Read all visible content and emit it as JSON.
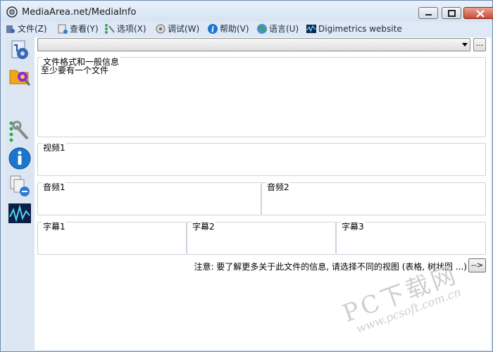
{
  "window": {
    "title": "MediaArea.net/MediaInfo"
  },
  "menu": [
    {
      "label": "文件(Z)",
      "icon": "file-icon"
    },
    {
      "label": "查看(Y)",
      "icon": "view-icon"
    },
    {
      "label": "选项(X)",
      "icon": "options-icon"
    },
    {
      "label": "调试(W)",
      "icon": "debug-icon"
    },
    {
      "label": "帮助(V)",
      "icon": "help-icon"
    },
    {
      "label": "语言(U)",
      "icon": "language-icon"
    },
    {
      "label": "Digimetrics website",
      "icon": "digimetrics-icon"
    }
  ],
  "file_selector": {
    "value": "",
    "browse_label": "..."
  },
  "sidebar": [
    "open-file-icon",
    "open-folder-icon",
    "preferences-icon",
    "about-icon",
    "export-icon",
    "digimetrics-icon"
  ],
  "sections": {
    "general": {
      "label": "文件格式和一般信息",
      "content": "至少要有一个文件"
    },
    "video1": {
      "label": "视频1"
    },
    "audio1": {
      "label": "音频1"
    },
    "audio2": {
      "label": "音频2"
    },
    "subtitle1": {
      "label": "字幕1"
    },
    "subtitle2": {
      "label": "字幕2"
    },
    "subtitle3": {
      "label": "字幕3"
    }
  },
  "footer": {
    "note": "注意: 要了解更多关于此文件的信息, 请选择不同的视图 (表格, 树状图 ...)",
    "next_label": "-->"
  },
  "watermark": {
    "main": "PC下载网",
    "sub": "www.pcsoft.com.cn"
  },
  "colors": {
    "title_bar": "#dbe6f4",
    "close_button": "#c84b33",
    "accent_blue": "#1b76d1"
  }
}
